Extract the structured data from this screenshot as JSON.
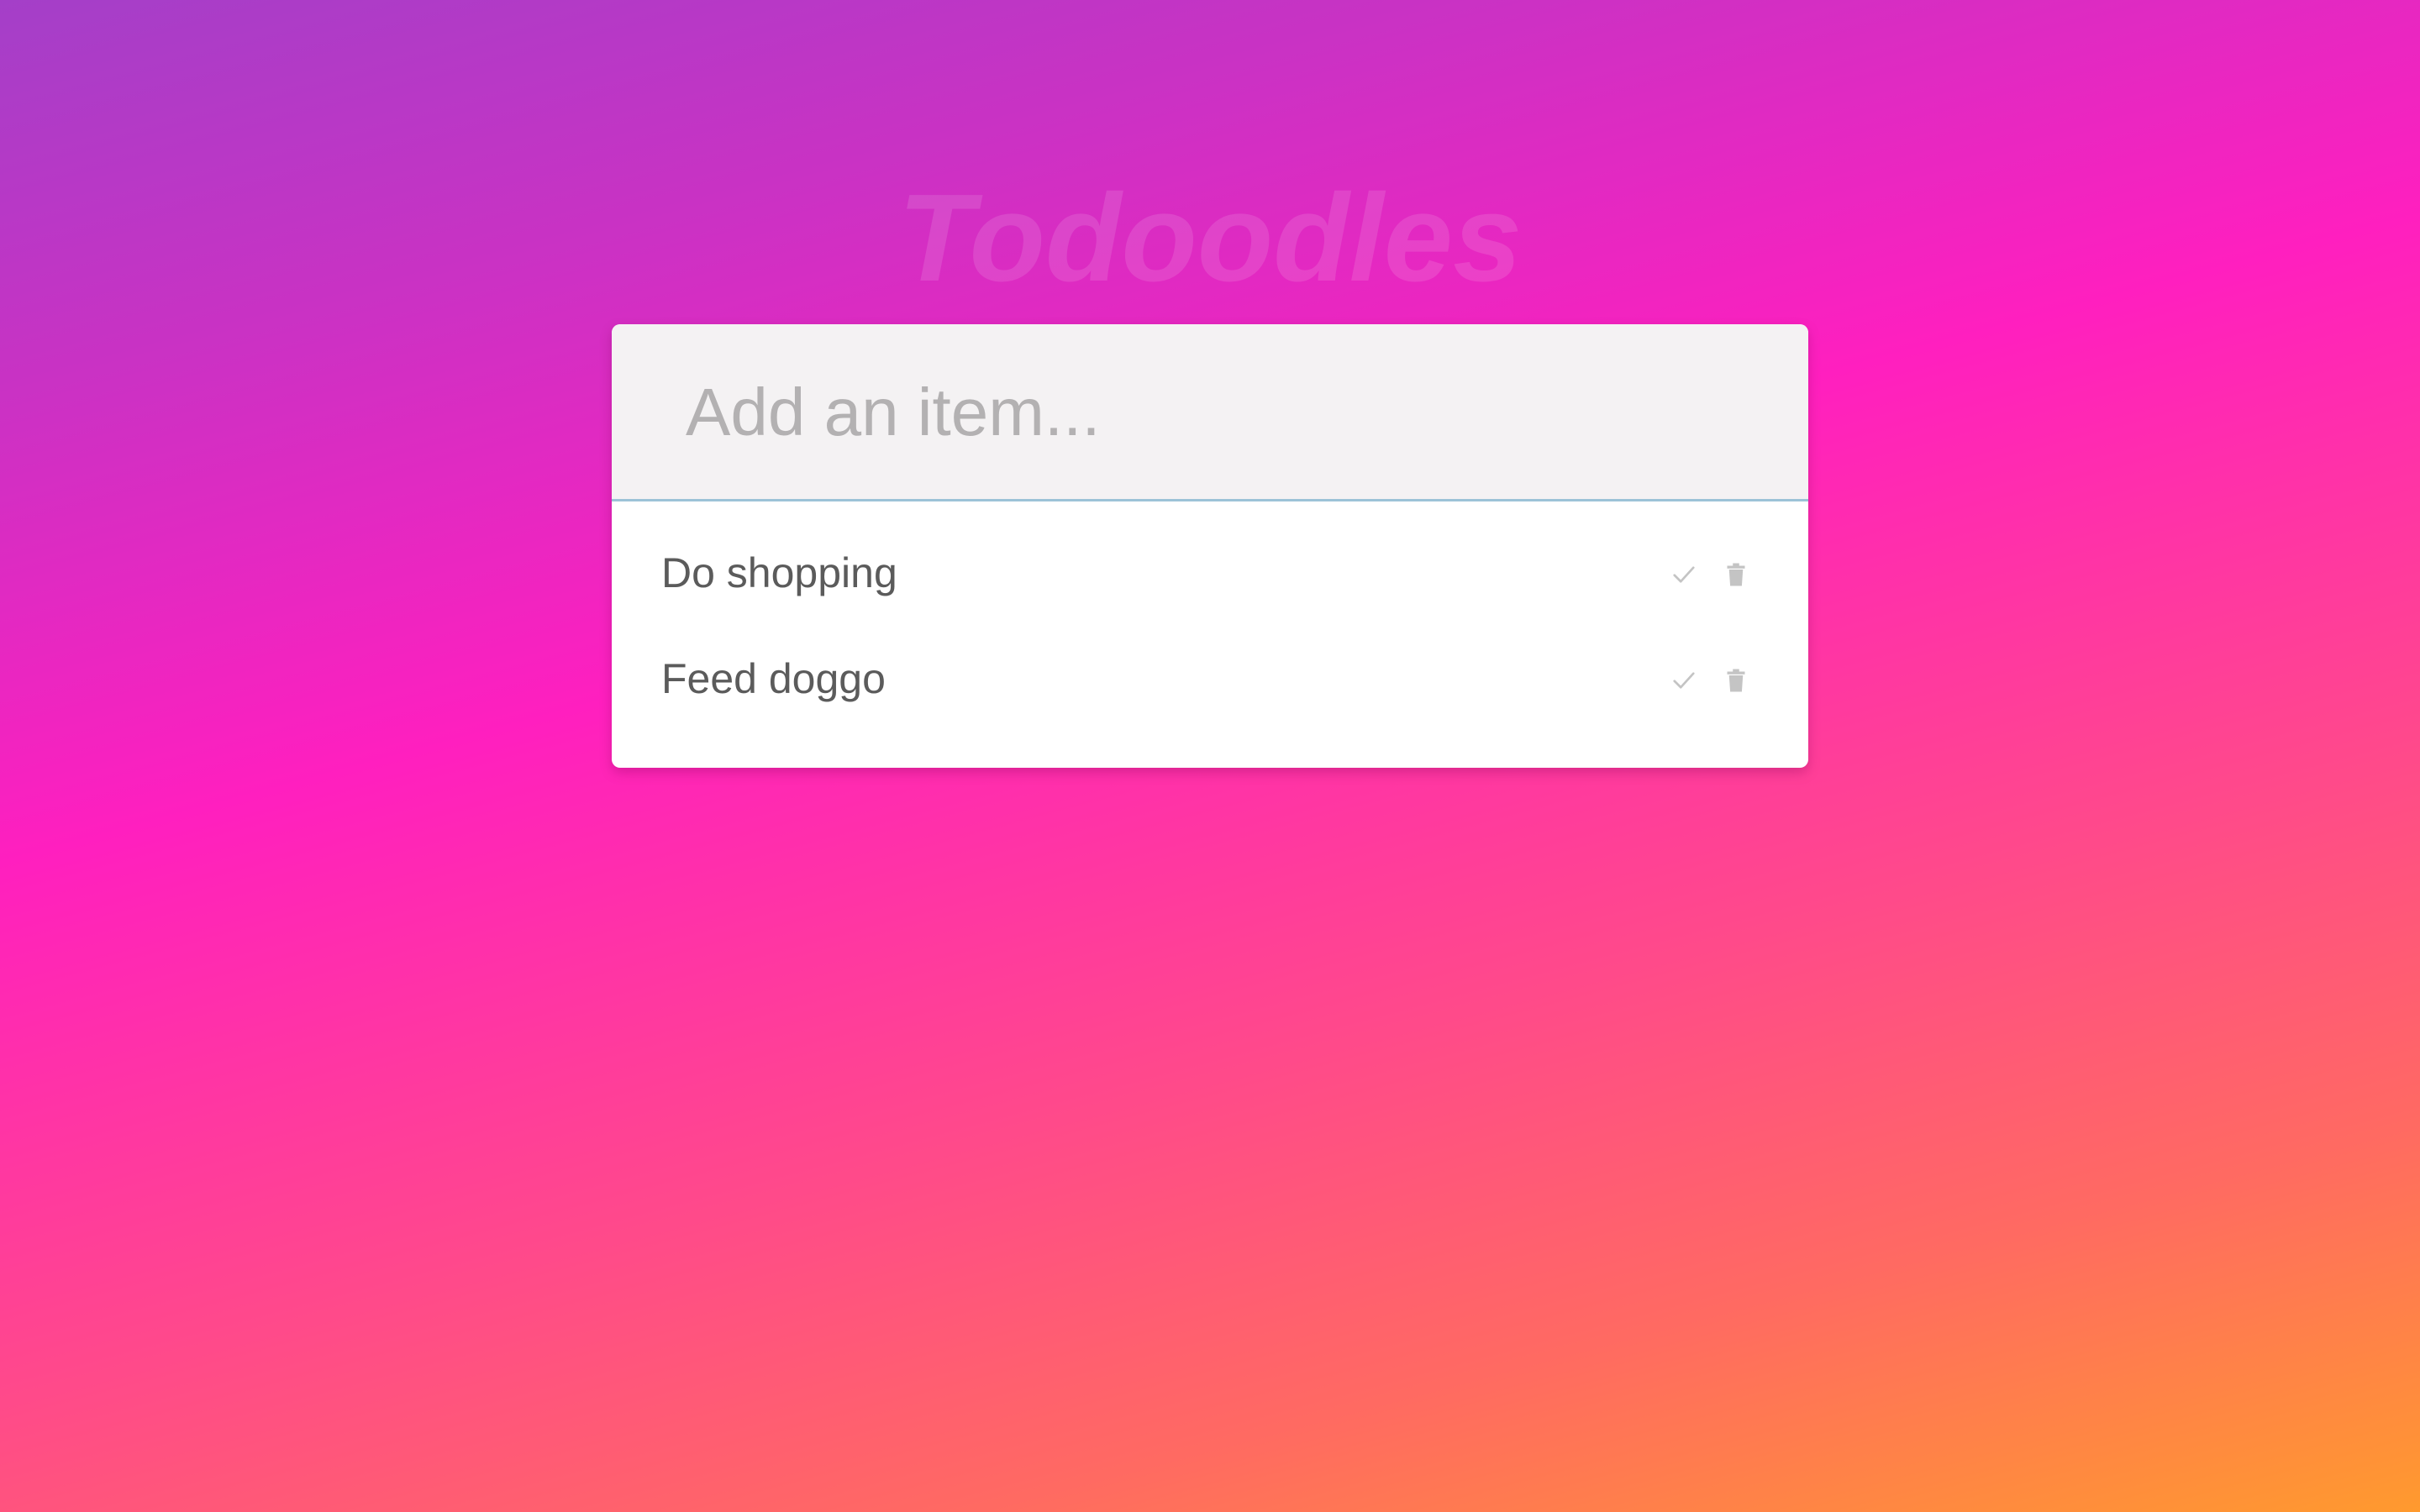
{
  "app": {
    "title": "Todoodles"
  },
  "new_item": {
    "placeholder": "Add an item...",
    "value": ""
  },
  "todos": [
    {
      "text": "Do shopping",
      "actions": [
        "check-icon",
        "trash-icon"
      ]
    },
    {
      "text": "Feed doggo",
      "actions": [
        "check-icon",
        "trash-icon"
      ]
    }
  ],
  "colors": {
    "background_top": "#a43fc8",
    "background_mid": "#ff1fbf",
    "background_bottom": "#ff9a2e",
    "card": "#ffffff",
    "input_bg": "#f4f2f3",
    "input_border": "#9cc3d7",
    "item_text": "#5b5b5b",
    "icon": "#c4c4c4"
  }
}
